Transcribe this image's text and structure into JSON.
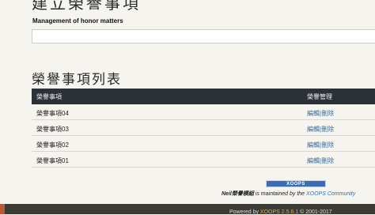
{
  "header": {
    "title": "建立榮譽事項",
    "subtitle": "Management of honor matters"
  },
  "input": {
    "value": "",
    "placeholder": ""
  },
  "list": {
    "title": "榮譽事項列表",
    "columns": [
      "榮譽事項",
      "榮譽管理"
    ],
    "rows": [
      {
        "name": "榮譽事項04",
        "edit": "編輯",
        "separator": "|",
        "delete": "刪除"
      },
      {
        "name": "榮譽事項03",
        "edit": "編輯",
        "separator": "|",
        "delete": "刪除"
      },
      {
        "name": "榮譽事項02",
        "edit": "編輯",
        "separator": "|",
        "delete": "刪除"
      },
      {
        "name": "榮譽事項01",
        "edit": "編輯",
        "separator": "|",
        "delete": "刪除"
      }
    ]
  },
  "footer": {
    "badge": "XOOPS",
    "credit_module": "Neil榮譽模組",
    "credit_text": " is maintained by the ",
    "credit_link": "XOOPS Community",
    "powered_prefix": "Powered by ",
    "powered_link": "XOOPS 2.5.8.1",
    "powered_suffix": " © 2001-2017"
  },
  "colors": {
    "header_bg": "#2b3137",
    "link": "#3a6ea5",
    "footer_bg": "#3c3a34",
    "footer_link": "#d9a84e"
  }
}
